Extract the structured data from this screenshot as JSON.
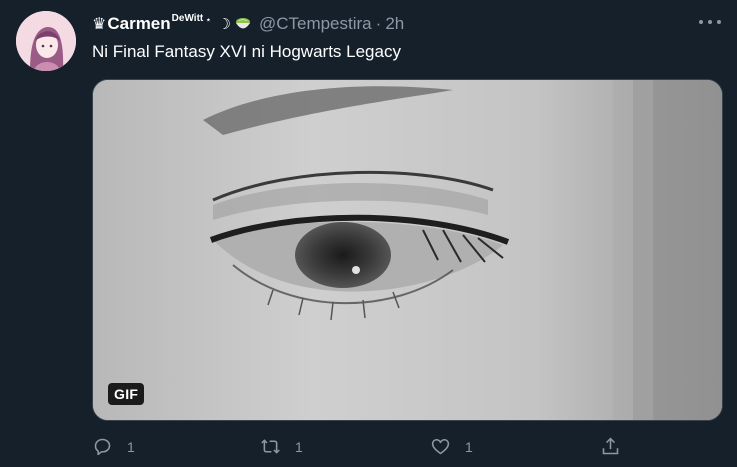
{
  "tweet": {
    "author": {
      "crown": "♛",
      "name": "Carmen",
      "name_sup": "DeWitt",
      "name_star": "⋆",
      "moon": "☽",
      "handle": "@CTempestira",
      "separator": "·",
      "time": "2h"
    },
    "text": "Ni Final Fantasy XVI ni Hogwarts Legacy",
    "media": {
      "badge": "GIF"
    },
    "actions": {
      "replies": "1",
      "retweets": "1",
      "likes": "1"
    }
  },
  "colors": {
    "background": "#15202b",
    "text": "#ffffff",
    "secondary": "#8b98a5",
    "border": "#38444d"
  }
}
